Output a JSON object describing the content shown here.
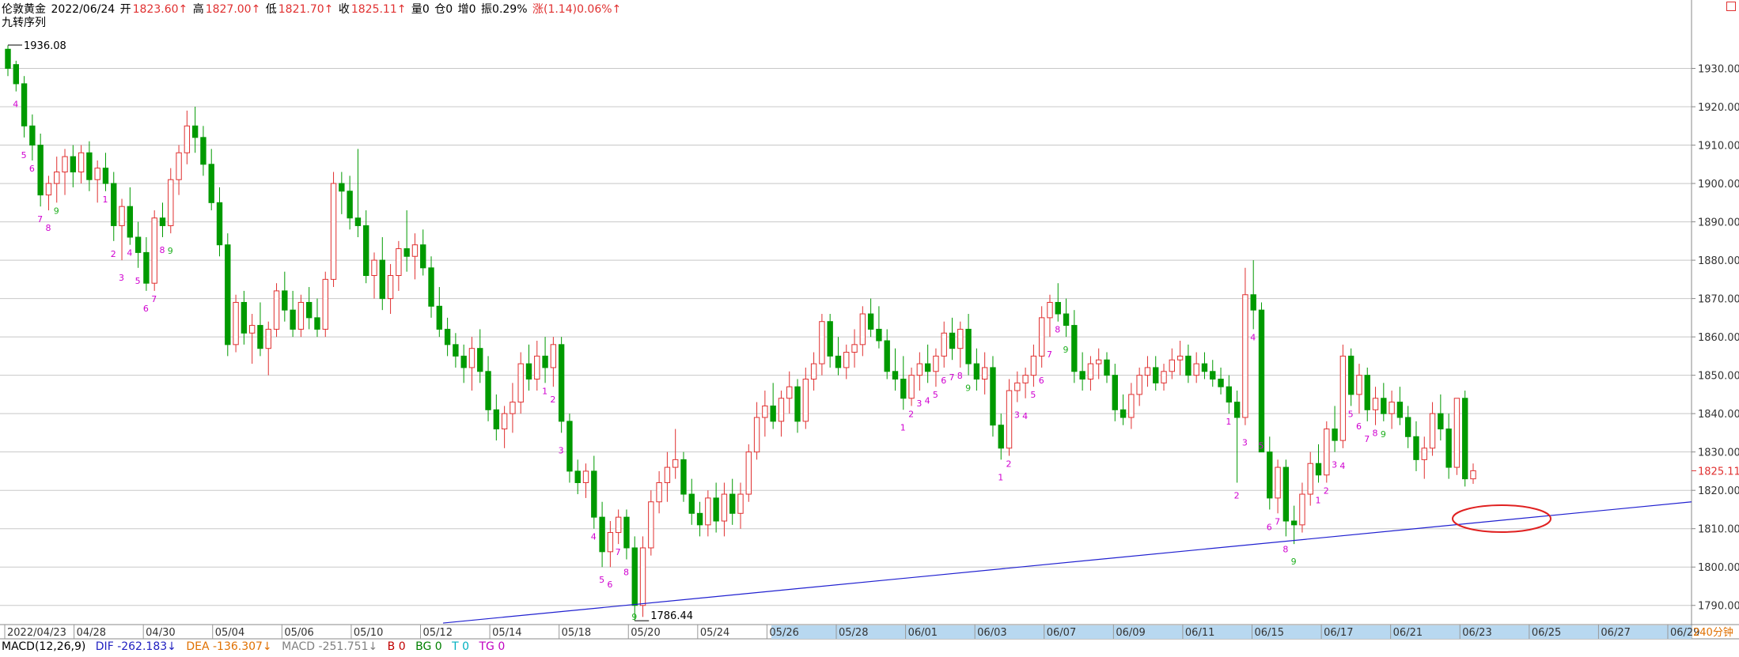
{
  "header": {
    "instrument": "伦敦黄金",
    "date": "2022/06/24",
    "open_label": "开",
    "open": "1823.60↑",
    "high_label": "高",
    "high": "1827.00↑",
    "low_label": "低",
    "low": "1821.70↑",
    "close_label": "收",
    "close": "1825.11↑",
    "volume": "量0",
    "position": "仓0",
    "increase": "增0",
    "amplitude": "振0.29%",
    "change": "涨(1.14)0.06%↑",
    "indicator_name": "九转序列"
  },
  "colors": {
    "up": "#e03030",
    "down": "#009a00",
    "grid": "#c8c8c8",
    "trendline": "#2020d0",
    "td_seq": "#d000d0",
    "td_nine": "#20b020",
    "axis_text": "#333333",
    "price_label": "#e03030",
    "timebar": "#b8d8f0"
  },
  "macd": {
    "name": "MACD(12,26,9)",
    "dif": "DIF -262.183↓",
    "dea": "DEA -136.307↓",
    "macd": "MACD -251.751↓",
    "b": "B 0",
    "bg": "BG 0",
    "t": "T 0",
    "tg": "TG 0"
  },
  "period_label": "240分钟",
  "chart_data": {
    "type": "candlestick",
    "ylim": [
      1785,
      1940
    ],
    "y_ticks": [
      1790,
      1800,
      1810,
      1820,
      1830,
      1840,
      1850,
      1860,
      1870,
      1880,
      1890,
      1900,
      1910,
      1920,
      1930
    ],
    "y_tick_labels": [
      "1790.00",
      "1800.00",
      "1810.00",
      "1820.00",
      "1830.00",
      "1840.00",
      "1850.00",
      "1860.00",
      "1870.00",
      "1880.00",
      "1890.00",
      "1900.00",
      "1910.00",
      "1920.00",
      "1930.00"
    ],
    "x_labels": [
      "2022/04/23",
      "04/28",
      "04/30",
      "05/04",
      "05/06",
      "05/10",
      "05/12",
      "05/14",
      "05/18",
      "05/20",
      "05/24",
      "05/26",
      "05/28",
      "06/01",
      "06/03",
      "06/07",
      "06/09",
      "06/11",
      "06/15",
      "06/17",
      "06/21",
      "06/23",
      "06/25",
      "06/27",
      "06/29"
    ],
    "max_label": "1936.08",
    "min_label": "1786.44",
    "current_price": "1825.11",
    "current_price_value": 1825.11,
    "annotation": "red ellipse marking price reaching the rising trendline near 06/23",
    "candles": [
      [
        1935,
        1936,
        1928,
        1930
      ],
      [
        1931,
        1932,
        1924,
        1926
      ],
      [
        1926,
        1928,
        1912,
        1915
      ],
      [
        1915,
        1918,
        1906,
        1910
      ],
      [
        1910,
        1913,
        1894,
        1897
      ],
      [
        1897,
        1902,
        1893,
        1900
      ],
      [
        1900,
        1907,
        1895,
        1903
      ],
      [
        1903,
        1909,
        1897,
        1907
      ],
      [
        1907,
        1910,
        1899,
        1903
      ],
      [
        1903,
        1910,
        1900,
        1908
      ],
      [
        1908,
        1911,
        1898,
        1901
      ],
      [
        1901,
        1906,
        1895,
        1904
      ],
      [
        1904,
        1908,
        1898,
        1900
      ],
      [
        1900,
        1903,
        1885,
        1889
      ],
      [
        1889,
        1896,
        1880,
        1894
      ],
      [
        1894,
        1899,
        1884,
        1886
      ],
      [
        1886,
        1890,
        1878,
        1882
      ],
      [
        1882,
        1886,
        1872,
        1874
      ],
      [
        1874,
        1893,
        1872,
        1891
      ],
      [
        1891,
        1895,
        1886,
        1889
      ],
      [
        1889,
        1904,
        1887,
        1901
      ],
      [
        1901,
        1910,
        1897,
        1908
      ],
      [
        1908,
        1919,
        1905,
        1915
      ],
      [
        1915,
        1920,
        1908,
        1912
      ],
      [
        1912,
        1915,
        1902,
        1905
      ],
      [
        1905,
        1909,
        1893,
        1895
      ],
      [
        1895,
        1899,
        1881,
        1884
      ],
      [
        1884,
        1887,
        1855,
        1858
      ],
      [
        1858,
        1871,
        1856,
        1869
      ],
      [
        1869,
        1872,
        1858,
        1861
      ],
      [
        1861,
        1866,
        1853,
        1863
      ],
      [
        1863,
        1869,
        1855,
        1857
      ],
      [
        1857,
        1864,
        1850,
        1862
      ],
      [
        1862,
        1874,
        1860,
        1872
      ],
      [
        1872,
        1877,
        1864,
        1867
      ],
      [
        1867,
        1872,
        1860,
        1862
      ],
      [
        1862,
        1871,
        1860,
        1869
      ],
      [
        1869,
        1873,
        1862,
        1865
      ],
      [
        1865,
        1870,
        1860,
        1862
      ],
      [
        1862,
        1877,
        1860,
        1875
      ],
      [
        1875,
        1903,
        1873,
        1900
      ],
      [
        1900,
        1903,
        1892,
        1898
      ],
      [
        1898,
        1902,
        1888,
        1891
      ],
      [
        1891,
        1909,
        1886,
        1889
      ],
      [
        1889,
        1893,
        1874,
        1876
      ],
      [
        1876,
        1882,
        1870,
        1880
      ],
      [
        1880,
        1886,
        1867,
        1870
      ],
      [
        1870,
        1879,
        1866,
        1876
      ],
      [
        1876,
        1885,
        1872,
        1883
      ],
      [
        1883,
        1893,
        1877,
        1881
      ],
      [
        1881,
        1887,
        1875,
        1884
      ],
      [
        1884,
        1888,
        1876,
        1878
      ],
      [
        1878,
        1881,
        1865,
        1868
      ],
      [
        1868,
        1873,
        1860,
        1862
      ],
      [
        1862,
        1865,
        1855,
        1858
      ],
      [
        1858,
        1861,
        1852,
        1855
      ],
      [
        1855,
        1858,
        1848,
        1852
      ],
      [
        1852,
        1860,
        1846,
        1857
      ],
      [
        1857,
        1862,
        1848,
        1851
      ],
      [
        1851,
        1855,
        1838,
        1841
      ],
      [
        1841,
        1845,
        1833,
        1836
      ],
      [
        1836,
        1842,
        1831,
        1840
      ],
      [
        1840,
        1848,
        1835,
        1843
      ],
      [
        1843,
        1856,
        1840,
        1853
      ],
      [
        1853,
        1858,
        1846,
        1849
      ],
      [
        1849,
        1859,
        1846,
        1855
      ],
      [
        1855,
        1860,
        1848,
        1852
      ],
      [
        1852,
        1860,
        1847,
        1858
      ],
      [
        1858,
        1860,
        1835,
        1838
      ],
      [
        1838,
        1840,
        1822,
        1825
      ],
      [
        1825,
        1828,
        1819,
        1822
      ],
      [
        1822,
        1827,
        1818,
        1825
      ],
      [
        1825,
        1829,
        1810,
        1813
      ],
      [
        1813,
        1817,
        1800,
        1804
      ],
      [
        1804,
        1812,
        1800,
        1809
      ],
      [
        1809,
        1815,
        1806,
        1813
      ],
      [
        1813,
        1815,
        1802,
        1805
      ],
      [
        1805,
        1808,
        1786,
        1790
      ],
      [
        1790,
        1808,
        1787,
        1805
      ],
      [
        1805,
        1820,
        1803,
        1817
      ],
      [
        1817,
        1825,
        1814,
        1822
      ],
      [
        1822,
        1830,
        1817,
        1826
      ],
      [
        1826,
        1836,
        1823,
        1828
      ],
      [
        1828,
        1830,
        1817,
        1819
      ],
      [
        1819,
        1823,
        1811,
        1814
      ],
      [
        1814,
        1817,
        1808,
        1811
      ],
      [
        1811,
        1820,
        1808,
        1818
      ],
      [
        1818,
        1822,
        1809,
        1812
      ],
      [
        1812,
        1822,
        1808,
        1819
      ],
      [
        1819,
        1823,
        1811,
        1814
      ],
      [
        1814,
        1822,
        1810,
        1819
      ],
      [
        1819,
        1832,
        1817,
        1830
      ],
      [
        1830,
        1843,
        1828,
        1839
      ],
      [
        1839,
        1846,
        1834,
        1842
      ],
      [
        1842,
        1848,
        1836,
        1838
      ],
      [
        1838,
        1846,
        1834,
        1844
      ],
      [
        1844,
        1851,
        1840,
        1847
      ],
      [
        1847,
        1849,
        1835,
        1838
      ],
      [
        1838,
        1852,
        1836,
        1849
      ],
      [
        1849,
        1856,
        1846,
        1853
      ],
      [
        1853,
        1866,
        1850,
        1864
      ],
      [
        1864,
        1866,
        1852,
        1855
      ],
      [
        1855,
        1860,
        1850,
        1852
      ],
      [
        1852,
        1858,
        1849,
        1856
      ],
      [
        1856,
        1862,
        1852,
        1858
      ],
      [
        1858,
        1868,
        1855,
        1866
      ],
      [
        1866,
        1870,
        1860,
        1862
      ],
      [
        1862,
        1868,
        1857,
        1859
      ],
      [
        1859,
        1862,
        1849,
        1851
      ],
      [
        1851,
        1857,
        1846,
        1849
      ],
      [
        1849,
        1855,
        1841,
        1844
      ],
      [
        1844,
        1852,
        1842,
        1850
      ],
      [
        1850,
        1856,
        1846,
        1853
      ],
      [
        1853,
        1858,
        1848,
        1851
      ],
      [
        1851,
        1857,
        1847,
        1855
      ],
      [
        1855,
        1864,
        1852,
        1861
      ],
      [
        1861,
        1865,
        1854,
        1857
      ],
      [
        1857,
        1864,
        1852,
        1862
      ],
      [
        1862,
        1866,
        1850,
        1853
      ],
      [
        1853,
        1857,
        1846,
        1849
      ],
      [
        1849,
        1856,
        1845,
        1852
      ],
      [
        1852,
        1855,
        1834,
        1837
      ],
      [
        1837,
        1840,
        1828,
        1831
      ],
      [
        1831,
        1849,
        1829,
        1846
      ],
      [
        1846,
        1851,
        1843,
        1848
      ],
      [
        1848,
        1852,
        1844,
        1850
      ],
      [
        1850,
        1858,
        1847,
        1855
      ],
      [
        1855,
        1868,
        1852,
        1865
      ],
      [
        1865,
        1871,
        1860,
        1869
      ],
      [
        1869,
        1874,
        1864,
        1866
      ],
      [
        1866,
        1870,
        1860,
        1863
      ],
      [
        1863,
        1867,
        1848,
        1851
      ],
      [
        1851,
        1856,
        1846,
        1849
      ],
      [
        1849,
        1855,
        1846,
        1853
      ],
      [
        1853,
        1857,
        1849,
        1854
      ],
      [
        1854,
        1856,
        1848,
        1850
      ],
      [
        1850,
        1853,
        1838,
        1841
      ],
      [
        1841,
        1845,
        1837,
        1839
      ],
      [
        1839,
        1848,
        1836,
        1845
      ],
      [
        1845,
        1852,
        1842,
        1850
      ],
      [
        1850,
        1855,
        1847,
        1852
      ],
      [
        1852,
        1855,
        1846,
        1848
      ],
      [
        1848,
        1853,
        1846,
        1851
      ],
      [
        1851,
        1857,
        1849,
        1854
      ],
      [
        1854,
        1859,
        1850,
        1855
      ],
      [
        1855,
        1858,
        1848,
        1850
      ],
      [
        1850,
        1856,
        1848,
        1853
      ],
      [
        1853,
        1856,
        1849,
        1851
      ],
      [
        1851,
        1854,
        1847,
        1849
      ],
      [
        1849,
        1852,
        1845,
        1847
      ],
      [
        1847,
        1850,
        1840,
        1843
      ],
      [
        1843,
        1846,
        1822,
        1839
      ],
      [
        1839,
        1878,
        1837,
        1871
      ],
      [
        1871,
        1880,
        1862,
        1867
      ],
      [
        1867,
        1869,
        1835,
        1830
      ],
      [
        1830,
        1834,
        1815,
        1818
      ],
      [
        1818,
        1828,
        1814,
        1826
      ],
      [
        1826,
        1828,
        1808,
        1812
      ],
      [
        1812,
        1816,
        1806,
        1811
      ],
      [
        1811,
        1822,
        1809,
        1819
      ],
      [
        1819,
        1830,
        1816,
        1827
      ],
      [
        1827,
        1832,
        1822,
        1824
      ],
      [
        1824,
        1838,
        1822,
        1836
      ],
      [
        1836,
        1842,
        1830,
        1833
      ],
      [
        1833,
        1858,
        1831,
        1855
      ],
      [
        1855,
        1857,
        1842,
        1845
      ],
      [
        1845,
        1853,
        1840,
        1850
      ],
      [
        1850,
        1852,
        1838,
        1841
      ],
      [
        1841,
        1847,
        1837,
        1844
      ],
      [
        1844,
        1848,
        1838,
        1840
      ],
      [
        1840,
        1846,
        1836,
        1843
      ],
      [
        1843,
        1847,
        1837,
        1839
      ],
      [
        1839,
        1842,
        1831,
        1834
      ],
      [
        1834,
        1838,
        1825,
        1828
      ],
      [
        1828,
        1834,
        1823,
        1831
      ],
      [
        1831,
        1843,
        1829,
        1840
      ],
      [
        1840,
        1845,
        1833,
        1836
      ],
      [
        1836,
        1840,
        1823,
        1826
      ],
      [
        1826,
        1838,
        1824,
        1844
      ],
      [
        1844,
        1846,
        1821,
        1823
      ],
      [
        1823,
        1827,
        1821.7,
        1825.11
      ]
    ],
    "td_sequences": [
      {
        "i": 1,
        "label": "4",
        "kind": "sell"
      },
      {
        "i": 2,
        "label": "5",
        "kind": "sell"
      },
      {
        "i": 3,
        "label": "6",
        "kind": "sell"
      },
      {
        "i": 4,
        "label": "7",
        "kind": "sell"
      },
      {
        "i": 5,
        "label": "8",
        "kind": "sell"
      },
      {
        "i": 6,
        "label": "9",
        "kind": "nine"
      },
      {
        "i": 12,
        "label": "1",
        "kind": "sell"
      },
      {
        "i": 13,
        "label": "2",
        "kind": "sell"
      },
      {
        "i": 14,
        "label": "3",
        "kind": "sell"
      },
      {
        "i": 15,
        "label": "4",
        "kind": "sell"
      },
      {
        "i": 16,
        "label": "5",
        "kind": "sell"
      },
      {
        "i": 17,
        "label": "6",
        "kind": "sell"
      },
      {
        "i": 18,
        "label": "7",
        "kind": "sell"
      },
      {
        "i": 19,
        "label": "8",
        "kind": "sell"
      },
      {
        "i": 20,
        "label": "9",
        "kind": "nine"
      },
      {
        "i": 66,
        "label": "1",
        "kind": "sell"
      },
      {
        "i": 67,
        "label": "2",
        "kind": "sell"
      },
      {
        "i": 68,
        "label": "3",
        "kind": "sell"
      },
      {
        "i": 72,
        "label": "4",
        "kind": "sell"
      },
      {
        "i": 73,
        "label": "5",
        "kind": "sell"
      },
      {
        "i": 74,
        "label": "6",
        "kind": "sell"
      },
      {
        "i": 75,
        "label": "7",
        "kind": "sell"
      },
      {
        "i": 76,
        "label": "8",
        "kind": "sell"
      },
      {
        "i": 77,
        "label": "9",
        "kind": "nine"
      },
      {
        "i": 110,
        "label": "1",
        "kind": "sell"
      },
      {
        "i": 111,
        "label": "2",
        "kind": "sell"
      },
      {
        "i": 112,
        "label": "3",
        "kind": "sell"
      },
      {
        "i": 113,
        "label": "4",
        "kind": "sell"
      },
      {
        "i": 114,
        "label": "5",
        "kind": "sell"
      },
      {
        "i": 115,
        "label": "6",
        "kind": "sell"
      },
      {
        "i": 116,
        "label": "7",
        "kind": "sell"
      },
      {
        "i": 117,
        "label": "8",
        "kind": "sell"
      },
      {
        "i": 118,
        "label": "9",
        "kind": "nine"
      },
      {
        "i": 122,
        "label": "1",
        "kind": "sell"
      },
      {
        "i": 123,
        "label": "2",
        "kind": "sell"
      },
      {
        "i": 124,
        "label": "3",
        "kind": "sell"
      },
      {
        "i": 125,
        "label": "4",
        "kind": "sell"
      },
      {
        "i": 126,
        "label": "5",
        "kind": "sell"
      },
      {
        "i": 127,
        "label": "6",
        "kind": "sell"
      },
      {
        "i": 128,
        "label": "7",
        "kind": "sell"
      },
      {
        "i": 129,
        "label": "8",
        "kind": "sell"
      },
      {
        "i": 130,
        "label": "9",
        "kind": "nine"
      },
      {
        "i": 150,
        "label": "1",
        "kind": "sell"
      },
      {
        "i": 151,
        "label": "2",
        "kind": "sell"
      },
      {
        "i": 152,
        "label": "3",
        "kind": "sell"
      },
      {
        "i": 153,
        "label": "4",
        "kind": "sell"
      },
      {
        "i": 154,
        "label": "5",
        "kind": "sell"
      },
      {
        "i": 155,
        "label": "6",
        "kind": "sell"
      },
      {
        "i": 156,
        "label": "7",
        "kind": "sell"
      },
      {
        "i": 157,
        "label": "8",
        "kind": "sell"
      },
      {
        "i": 158,
        "label": "9",
        "kind": "nine"
      },
      {
        "i": 161,
        "label": "1",
        "kind": "sell"
      },
      {
        "i": 162,
        "label": "2",
        "kind": "sell"
      },
      {
        "i": 163,
        "label": "3",
        "kind": "sell"
      },
      {
        "i": 164,
        "label": "4",
        "kind": "sell"
      },
      {
        "i": 165,
        "label": "5",
        "kind": "sell"
      },
      {
        "i": 166,
        "label": "6",
        "kind": "sell"
      },
      {
        "i": 167,
        "label": "7",
        "kind": "sell"
      },
      {
        "i": 168,
        "label": "8",
        "kind": "sell"
      },
      {
        "i": 169,
        "label": "9",
        "kind": "nine"
      }
    ]
  }
}
